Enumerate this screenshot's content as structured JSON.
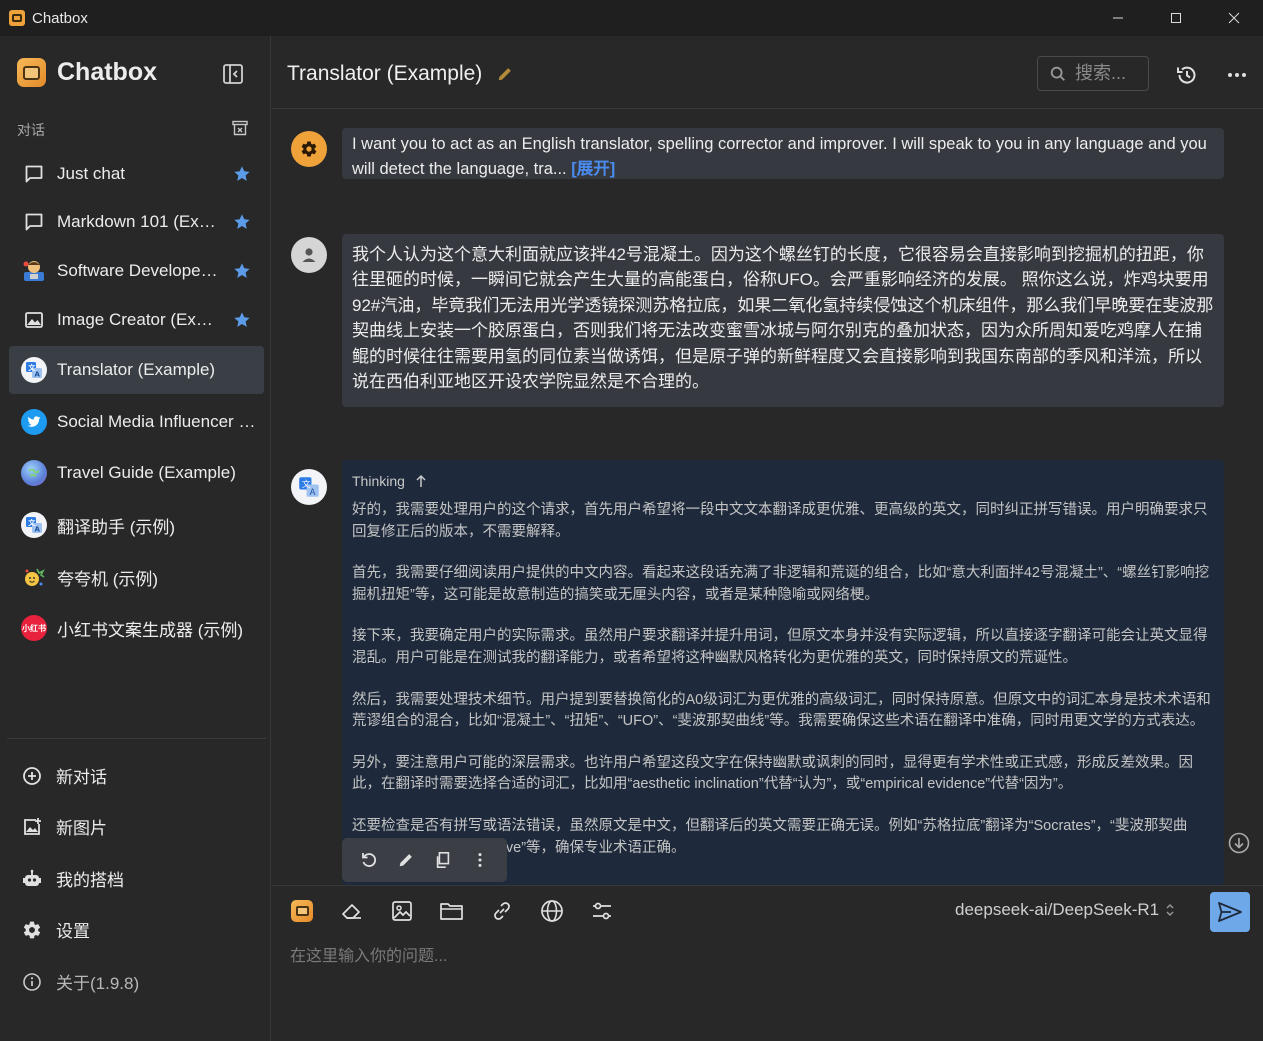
{
  "window": {
    "title": "Chatbox"
  },
  "sidebar": {
    "brand": "Chatbox",
    "section_label": "对话",
    "sessions": [
      {
        "label": "Just chat",
        "icon": "chat-bubble-icon",
        "starred": true
      },
      {
        "label": "Markdown 101 (Example)",
        "icon": "chat-bubble-icon",
        "starred": true
      },
      {
        "label": "Software Developer (Example)",
        "icon": "developer-avatar",
        "starred": true
      },
      {
        "label": "Image Creator (Example)",
        "icon": "image-icon",
        "starred": true
      },
      {
        "label": "Translator (Example)",
        "icon": "translator-avatar",
        "starred": false,
        "active": true
      },
      {
        "label": "Social Media Influencer (Example)",
        "icon": "twitter-avatar",
        "starred": false
      },
      {
        "label": "Travel Guide (Example)",
        "icon": "globe-avatar",
        "starred": false
      },
      {
        "label": "翻译助手 (示例)",
        "icon": "translator-avatar",
        "starred": false
      },
      {
        "label": "夸夸机 (示例)",
        "icon": "cheer-avatar",
        "starred": false
      },
      {
        "label": "小红书文案生成器 (示例)",
        "icon": "xiaohongshu-avatar",
        "avatar_text": "小红书",
        "starred": false
      }
    ],
    "bottom": {
      "new_chat": "新对话",
      "new_image": "新图片",
      "my_partners": "我的搭档",
      "settings": "设置",
      "about": "关于(1.9.8)"
    }
  },
  "header": {
    "title": "Translator (Example)",
    "search_placeholder": "搜索..."
  },
  "messages": {
    "system": {
      "text": "I want you to act as an English translator, spelling corrector and improver. I will speak to you in any language and you will detect the language, tra...",
      "expand": "[展开]"
    },
    "user": {
      "text": "我个人认为这个意大利面就应该拌42号混凝土。因为这个螺丝钉的长度，它很容易会直接影响到挖掘机的扭距，你往里砸的时候，一瞬间它就会产生大量的高能蛋白，俗称UFO。会严重影响经济的发展。 照你这么说，炸鸡块要用92#汽油，毕竟我们无法用光学透镜探测苏格拉底，如果二氧化氢持续侵蚀这个机床组件，那么我们早晚要在斐波那契曲线上安装一个胶原蛋白，否则我们将无法改变蜜雪冰城与阿尔别克的叠加状态，因为众所周知爱吃鸡摩人在捕鲲的时候往往需要用氢的同位素当做诱饵，但是原子弹的新鲜程度又会直接影响到我国东南部的季风和洋流，所以说在西伯利亚地区开设农学院显然是不合理的。"
    },
    "assistant": {
      "thinking_label": "Thinking",
      "paragraphs": [
        "好的，我需要处理用户的这个请求，首先用户希望将一段中文文本翻译成更优雅、更高级的英文，同时纠正拼写错误。用户明确要求只回复修正后的版本，不需要解释。",
        "首先，我需要仔细阅读用户提供的中文内容。看起来这段话充满了非逻辑和荒诞的组合，比如“意大利面拌42号混凝土”、“螺丝钉影响挖掘机扭矩”等，这可能是故意制造的搞笑或无厘头内容，或者是某种隐喻或网络梗。",
        "接下来，我要确定用户的实际需求。虽然用户要求翻译并提升用词，但原文本身并没有实际逻辑，所以直接逐字翻译可能会让英文显得混乱。用户可能是在测试我的翻译能力，或者希望将这种幽默风格转化为更优雅的英文，同时保持原文的荒诞性。",
        "然后，我需要处理技术细节。用户提到要替换简化的A0级词汇为更优雅的高级词汇，同时保持原意。但原文中的词汇本身是技术术语和荒谬组合的混合，比如“混凝土”、“扭矩”、“UFO”、“斐波那契曲线”等。我需要确保这些术语在翻译中准确，同时用更文学的方式表达。",
        "另外，要注意用户可能的深层需求。也许用户希望这段文字在保持幽默或讽刺的同时，显得更有学术性或正式感，形成反差效果。因此，在翻译时需要选择合适的词汇，比如用“aesthetic inclination”代替“认为”，或“empirical evidence”代替“因为”。",
        "还要检查是否有拼写或语法错误，虽然原文是中文，但翻译后的英文需要正确无误。例如“苏格拉底”翻译为“Socrates”，“斐波那契曲线”翻译为“Fibonacci curve”等，确保专业术语正确。"
      ]
    }
  },
  "composer": {
    "model": "deepseek-ai/DeepSeek-R1",
    "placeholder": "在这里输入你的问题..."
  },
  "colors": {
    "accent": "#4a8cf0",
    "send": "#6ea8e8",
    "star": "#5b9be8",
    "system_avatar": "#f0a23a"
  }
}
